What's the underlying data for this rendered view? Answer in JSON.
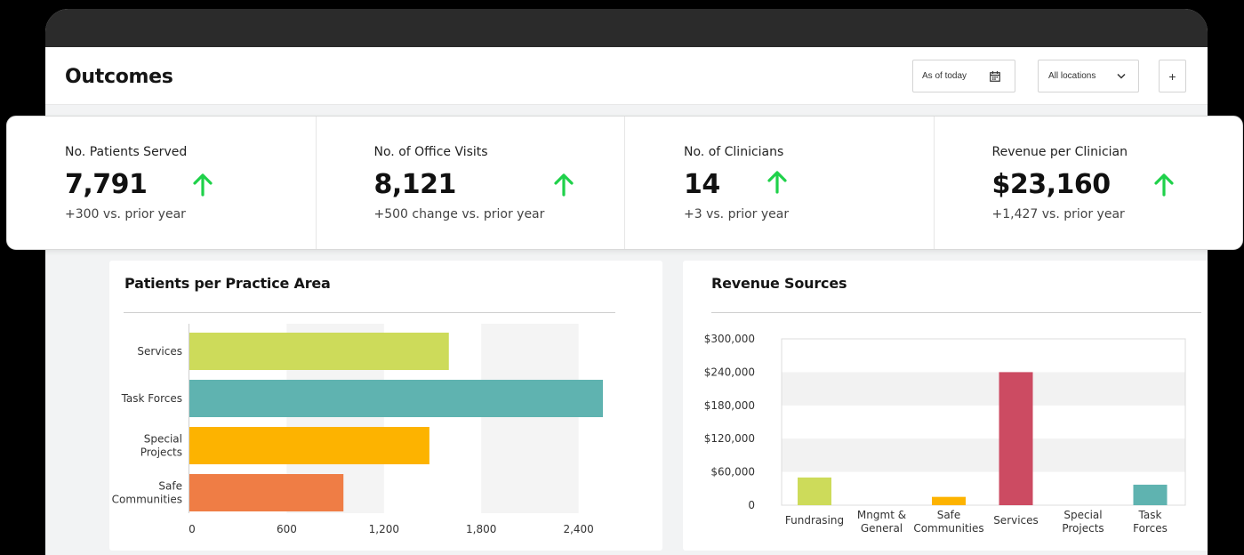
{
  "header": {
    "title": "Outcomes",
    "date_filter": "As of today",
    "location_filter": "All locations",
    "add_label": "+"
  },
  "kpis": [
    {
      "label": "No. Patients Served",
      "value": "7,791",
      "delta": "+300 vs. prior year"
    },
    {
      "label": "No. of Office Visits",
      "value": "8,121",
      "delta": "+500 change vs. prior year"
    },
    {
      "label": "No. of Clinicians",
      "value": "14",
      "delta": "+3 vs. prior year"
    },
    {
      "label": "Revenue per Clinician",
      "value": "$23,160",
      "delta": "+1,427 vs. prior year"
    }
  ],
  "colors": {
    "trend_up": "#1fd14a",
    "services": "#cddb5a",
    "task_forces": "#5fb3b0",
    "special_projects": "#fdb300",
    "safe_communities": "#ef7d45",
    "revenue_services": "#cc4b62"
  },
  "chart_data": [
    {
      "type": "bar",
      "orientation": "horizontal",
      "title": "Patients per Practice Area",
      "categories": [
        [
          "Services"
        ],
        [
          "Task Forces"
        ],
        [
          "Special",
          "Projects"
        ],
        [
          "Safe",
          "Communities"
        ]
      ],
      "values": [
        1600,
        2550,
        1480,
        950
      ],
      "colors": [
        "#cddb5a",
        "#5fb3b0",
        "#fdb300",
        "#ef7d45"
      ],
      "xticks": [
        "0",
        "600",
        "1,200",
        "1,800",
        "2,400"
      ],
      "xtick_values": [
        0,
        600,
        1200,
        1800,
        2400
      ],
      "xlim": [
        0,
        2550
      ]
    },
    {
      "type": "bar",
      "orientation": "vertical",
      "title": "Revenue Sources",
      "categories": [
        [
          "Fundrasing"
        ],
        [
          "Mngmt &",
          "General"
        ],
        [
          "Safe",
          "Communities"
        ],
        [
          "Services"
        ],
        [
          "Special",
          "Projects"
        ],
        [
          "Task",
          "Forces"
        ]
      ],
      "values": [
        50000,
        0,
        15000,
        240000,
        0,
        37000
      ],
      "colors": [
        "#cddb5a",
        "#cddb5a",
        "#fdb300",
        "#cc4b62",
        "#5fb3b0",
        "#5fb3b0"
      ],
      "yticks": [
        "$300,000",
        "$240,000",
        "$180,000",
        "$120,000",
        "$60,000",
        "0"
      ],
      "ytick_values": [
        300000,
        240000,
        180000,
        120000,
        60000,
        0
      ],
      "ylim": [
        0,
        300000
      ]
    }
  ]
}
